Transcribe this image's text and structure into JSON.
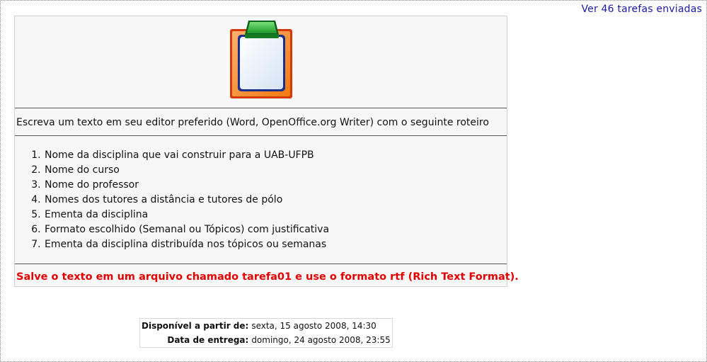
{
  "header": {
    "submissions_link": "Ver 46 tarefas enviadas"
  },
  "assignment": {
    "icon": "clipboard-icon",
    "instructions": "Escreva um texto em seu editor preferido (Word, OpenOffice.org Writer) com o seguinte roteiro",
    "steps": [
      "Nome da disciplina que vai construir para a UAB-UFPB",
      "Nome do curso",
      "Nome do professor",
      "Nomes dos tutores a distância e tutores de pólo",
      "Ementa da disciplina",
      "Formato escolhido (Semanal ou Tópicos) com justificativa",
      "Ementa da disciplina distribuída nos tópicos ou semanas"
    ],
    "warning": "Salve o texto em um arquivo chamado tarefa01 e use o formato rtf (Rich Text Format)."
  },
  "dates": {
    "available_label": "Disponível a partir de:",
    "available_value": "sexta, 15 agosto 2008, 14:30",
    "due_label": "Data de entrega:",
    "due_value": "domingo, 24 agosto 2008, 23:55"
  },
  "colors": {
    "link": "#1a1aa6",
    "warning": "#e00000"
  }
}
